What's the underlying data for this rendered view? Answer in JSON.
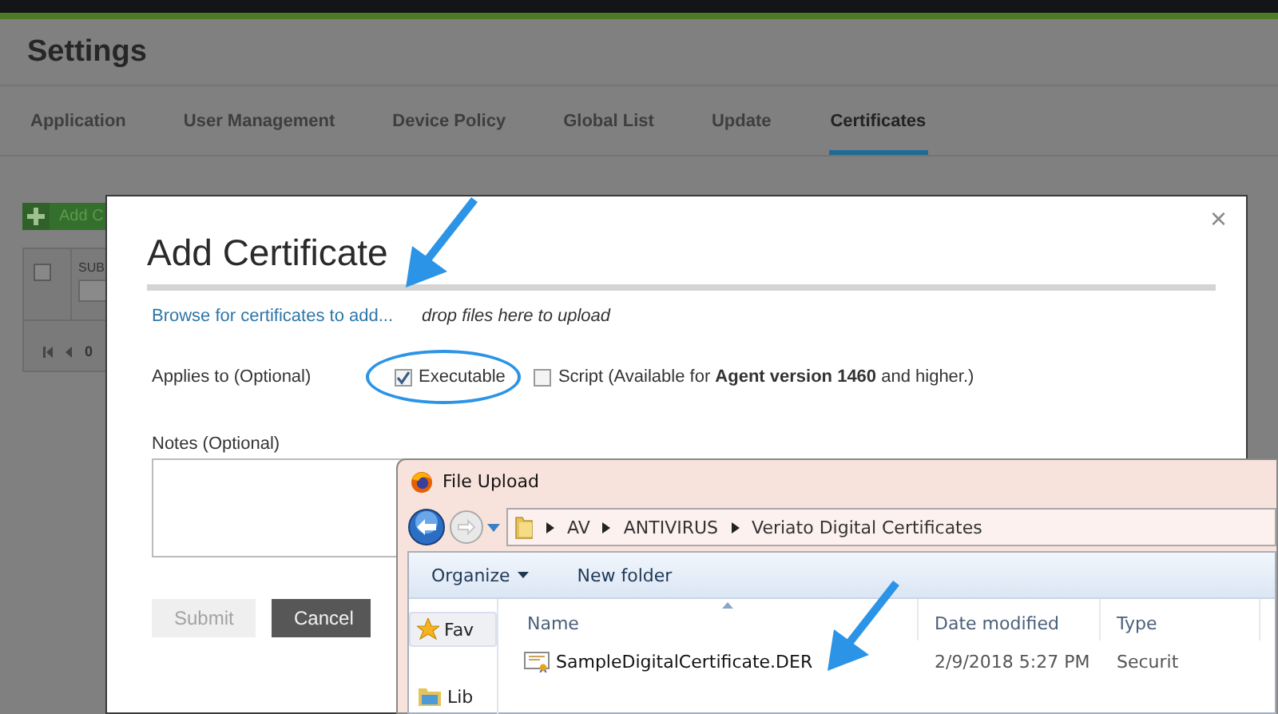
{
  "page": {
    "title": "Settings",
    "tabs": [
      {
        "label": "Application",
        "selected": false
      },
      {
        "label": "User Management",
        "selected": false
      },
      {
        "label": "Device Policy",
        "selected": false
      },
      {
        "label": "Global List",
        "selected": false
      },
      {
        "label": "Update",
        "selected": false
      },
      {
        "label": "Certificates",
        "selected": true
      }
    ],
    "add_button": "Add C",
    "table_checkbox": {
      "checked": false
    },
    "table_header": "SUB",
    "pager": "0"
  },
  "modal": {
    "title": "Add Certificate",
    "close": "×",
    "browse_link": "Browse for certificates to add...",
    "drop_hint": "drop files here to upload",
    "applies_label": "Applies to (Optional)",
    "options": [
      {
        "label": "Executable",
        "checked": true,
        "circled": true
      },
      {
        "label": "Script (Available for **Agent version 1460** and higher.)",
        "checked": false,
        "circled": false
      }
    ],
    "notes_label": "Notes (Optional)",
    "buttons": [
      {
        "label": "Submit",
        "disabled": true
      },
      {
        "label": "Cancel",
        "disabled": false
      }
    ]
  },
  "file_dialog": {
    "title": "File Upload",
    "path": [
      "AV",
      "ANTIVIRUS",
      "Veriato Digital Certificates"
    ],
    "toolbar": [
      {
        "label": "Organize",
        "kind": "menu"
      },
      {
        "label": "New folder",
        "kind": "button"
      }
    ],
    "nav": [
      {
        "label": "Fav",
        "kind": "favorites"
      },
      {
        "label": "Lib",
        "kind": "libraries"
      }
    ],
    "columns": [
      "Name",
      "Date modified",
      "Type"
    ],
    "files": [
      {
        "name": "SampleDigitalCertificate.DER",
        "date": "2/9/2018 5:27 PM",
        "type": "Securit"
      }
    ]
  }
}
